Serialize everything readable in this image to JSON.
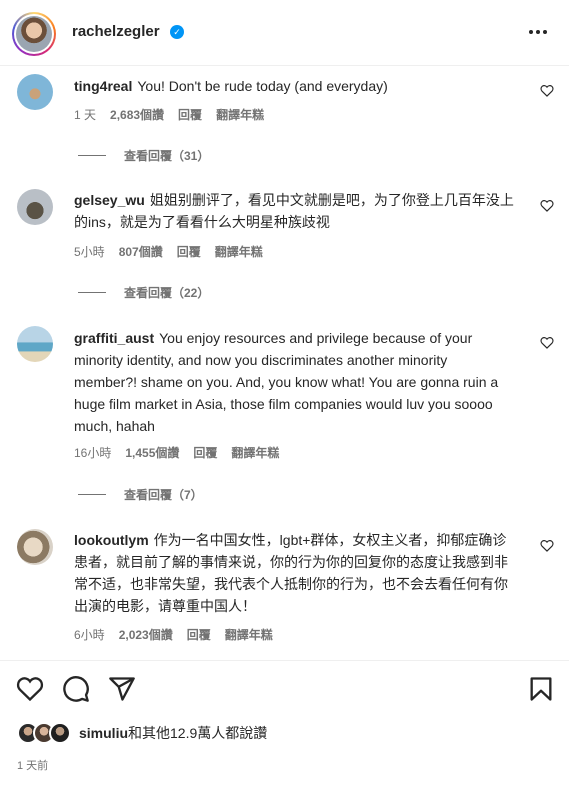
{
  "header": {
    "username": "rachelzegler",
    "verified_glyph": "✓",
    "more_icon": "more-horizontal-icon"
  },
  "comments": [
    {
      "user": "ting4real",
      "text": "You! Don't be rude today (and everyday)",
      "time": "1 天",
      "likes": "2,683個讚",
      "reply": "回覆",
      "translate": "翻譯年糕",
      "view_replies": "查看回覆（31）"
    },
    {
      "user": "gelsey_wu",
      "text": "姐姐别删评了，看见中文就删是吧，为了你登上几百年没上的ins，就是为了看看什么大明星种族歧视",
      "time": "5小時",
      "likes": "807個讚",
      "reply": "回覆",
      "translate": "翻譯年糕",
      "view_replies": "查看回覆（22）"
    },
    {
      "user": "graffiti_aust",
      "text": "You enjoy resources and privilege because of your minority identity, and now you discriminates another minority member?! shame on you. And, you know what! You are gonna ruin a huge film market in Asia, those film companies would luv you soooo much, hahah",
      "time": "16小時",
      "likes": "1,455個讚",
      "reply": "回覆",
      "translate": "翻譯年糕",
      "view_replies": "查看回覆（7）"
    },
    {
      "user": "lookoutlym",
      "text": "作为一名中国女性，lgbt+群体，女权主义者，抑郁症确诊患者，就目前了解的事情来说，你的行为你的回复你的态度让我感到非常不适，也非常失望，我代表个人抵制你的行为，也不会去看任何有你出演的电影，请尊重中国人！",
      "time": "6小時",
      "likes": "2,023個讚",
      "reply": "回覆",
      "translate": "翻譯年糕"
    }
  ],
  "footer": {
    "liked_by_user": "simuliu",
    "liked_by_rest": "和其他12.9萬人都說讚",
    "time_ago": "1 天前"
  },
  "colors": {
    "text": "#262626",
    "secondary": "#737373",
    "verified": "#0095f6"
  }
}
